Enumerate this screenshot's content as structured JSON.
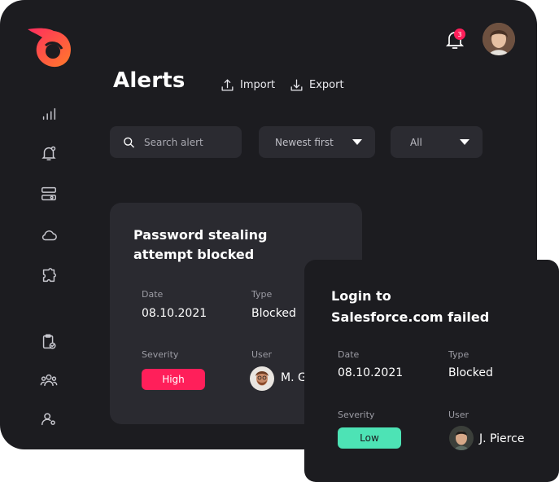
{
  "page": {
    "title": "Alerts"
  },
  "toolbar": {
    "import_label": "Import",
    "export_label": "Export"
  },
  "filters": {
    "search_placeholder": "Search alert",
    "sort_value": "Newest first",
    "type_value": "All"
  },
  "notifications": {
    "count": "3"
  },
  "cards": [
    {
      "title_line1": "Password stealing",
      "title_line2": "attempt blocked",
      "date_label": "Date",
      "date": "08.10.2021",
      "type_label": "Type",
      "type": "Blocked",
      "severity_label": "Severity",
      "severity": "High",
      "user_label": "User",
      "user": "M. G"
    },
    {
      "title_line1": "Login to",
      "title_line2": "Salesforce.com failed",
      "date_label": "Date",
      "date": "08.10.2021",
      "type_label": "Type",
      "type": "Blocked",
      "severity_label": "Severity",
      "severity": "Low",
      "user_label": "User",
      "user": "J. Pierce"
    }
  ],
  "colors": {
    "app_bg": "#1c1c20",
    "card_bg": "#2a2a30",
    "severity_high": "#ff1f5a",
    "severity_low": "#4de3b5",
    "badge": "#ff1f5a"
  },
  "icons": {
    "logo": "brand-logo",
    "nav": [
      "chart-bars-icon",
      "bell-alert-icon",
      "toggle-settings-icon",
      "cloud-icon",
      "puzzle-icon",
      "clipboard-check-icon",
      "users-icon",
      "user-gear-icon"
    ],
    "bell": "bell-icon",
    "search": "search-icon"
  }
}
